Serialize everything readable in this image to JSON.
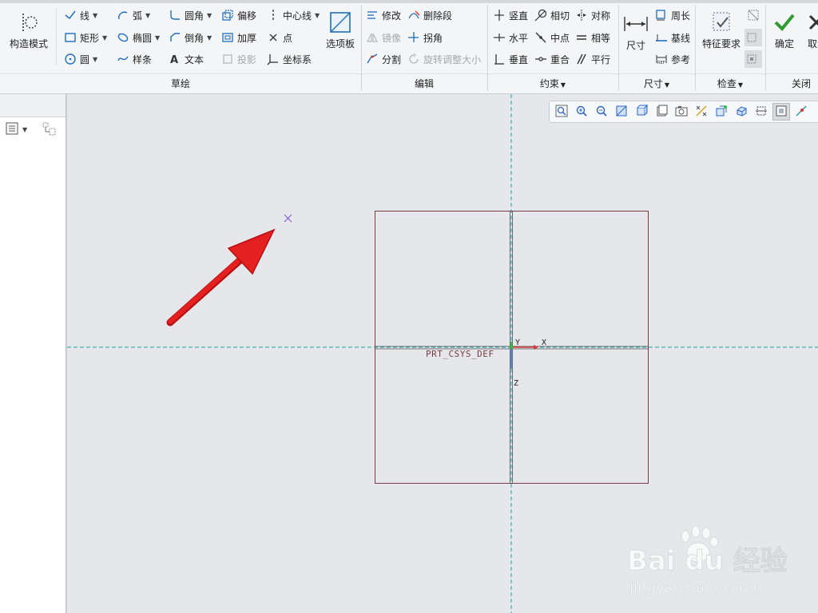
{
  "ribbon": {
    "groups": {
      "sketch": "草绘",
      "edit": "编辑",
      "constrain": "约束",
      "dimension": "尺寸",
      "inspect": "检查",
      "close": "关闭"
    },
    "construction_mode": "构造模式",
    "sketch_tools": {
      "line": "线",
      "rectangle": "矩形",
      "circle": "圆",
      "arc": "弧",
      "ellipse": "椭圆",
      "spline": "样条",
      "fillet": "圆角",
      "chamfer": "倒角",
      "text": "文本",
      "offset": "偏移",
      "thicken": "加厚",
      "project": "投影",
      "centerline": "中心线",
      "point": "点",
      "coord_system": "坐标系",
      "palette": "选项板"
    },
    "edit_tools": {
      "modify": "修改",
      "delete_segment": "删除段",
      "mirror": "镜像",
      "corner": "拐角",
      "divide": "分割",
      "rotate_resize": "旋转调整大小"
    },
    "constrain_tools": {
      "vertical": "竖直",
      "tangent": "相切",
      "symmetric": "对称",
      "horizontal": "水平",
      "midpoint": "中点",
      "equal": "相等",
      "perpendicular": "垂直",
      "coincident": "重合",
      "parallel": "平行"
    },
    "dimension_tools": {
      "dimension": "尺寸",
      "perimeter": "周长",
      "baseline": "基线",
      "reference": "参考"
    },
    "inspect_tools": {
      "feature_requirements": "特征要求"
    },
    "close_tools": {
      "ok": "确定",
      "cancel": "取消"
    }
  },
  "canvas": {
    "csys_label": "PRT_CSYS_DEF",
    "axis_x": "X",
    "axis_y": "Y",
    "axis_z": "Z"
  },
  "watermark": {
    "brand": "Bai du 经验",
    "url": "jingyan.baidu.com"
  },
  "colors": {
    "centerline": "#1aa3a3",
    "sketch_line": "#7a3b44",
    "arrow": "#e01818",
    "point_marker": "#7b4fd6",
    "confirm": "#2f9a2f"
  }
}
